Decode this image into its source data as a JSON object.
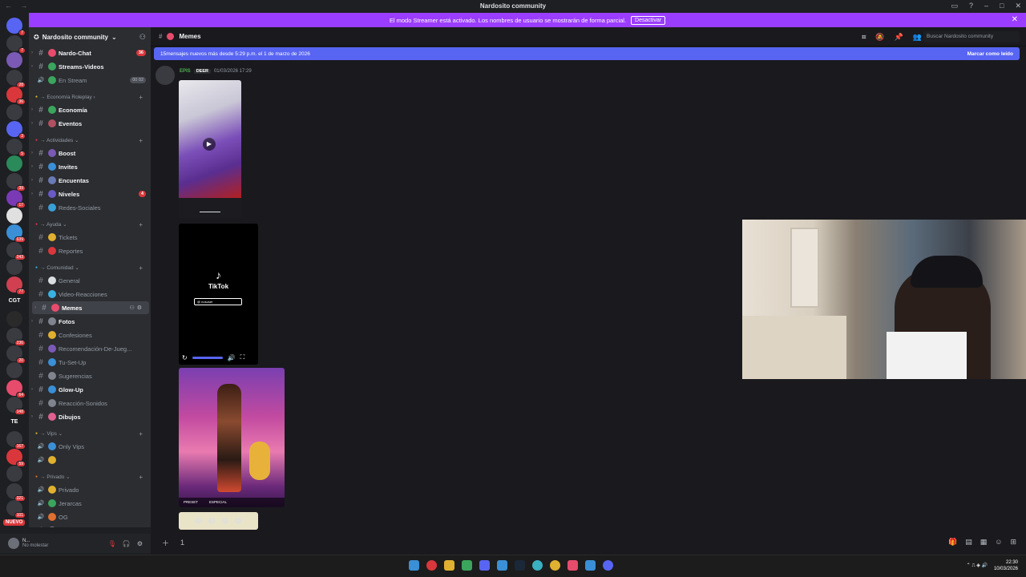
{
  "window": {
    "title": "Nardosito community",
    "nav": "← →"
  },
  "banner": {
    "text": "El modo Streamer está activado. Los nombres de usuario se mostrarán de forma parcial.",
    "button": "Desactivar"
  },
  "guild_badges": [
    "7",
    "7",
    "28",
    "36",
    "3",
    "5",
    "39",
    "17",
    "639",
    "243",
    "77",
    "12",
    "236",
    "20",
    "64",
    "148",
    "167",
    "59",
    "321",
    "101",
    "36",
    "77"
  ],
  "guild_text": [
    "CGT",
    "TE"
  ],
  "nuevo": "NUEVO",
  "server": {
    "name": "Nardosito community"
  },
  "channels": [
    {
      "type": "text",
      "name": "Nardo-Chat",
      "bright": true,
      "count": "36",
      "color": "#e74c6c"
    },
    {
      "type": "text",
      "name": "Streams-Videos",
      "bright": true,
      "color": "#3ba55d"
    },
    {
      "type": "voice",
      "name": "En Stream",
      "bright": false,
      "count": "00 02",
      "gray": true,
      "color": "#3ba55d"
    }
  ],
  "categories": [
    {
      "name": "→ Economía Roleplay ›",
      "channels": [
        {
          "name": "Economía",
          "bright": true,
          "color": "#3ba55d"
        },
        {
          "name": "Eventos",
          "bright": true,
          "color": "#b05060"
        }
      ]
    },
    {
      "name": "→ Actividades ⌄",
      "channels": [
        {
          "name": "Boost",
          "bright": true,
          "color": "#7a5ab5"
        },
        {
          "name": "Invites",
          "bright": true,
          "color": "#3a8fd6"
        },
        {
          "name": "Encuentas",
          "bright": true,
          "color": "#6a7ab5"
        },
        {
          "name": "Niveles",
          "bright": true,
          "count": "4",
          "color": "#6a5ac5"
        },
        {
          "name": "Redes-Sociales",
          "bright": false,
          "color": "#3a9fd6"
        }
      ]
    },
    {
      "name": "→ Ayuda ⌄",
      "channels": [
        {
          "name": "Tickets",
          "bright": false,
          "color": "#e0b030"
        },
        {
          "name": "Reportes",
          "bright": false,
          "color": "#da373c"
        }
      ]
    },
    {
      "name": "→ Comunidad ⌄",
      "channels": [
        {
          "name": "General",
          "bright": false,
          "color": "#dbdee1"
        },
        {
          "name": "Video-Reacciones",
          "bright": false,
          "color": "#3ab0e0"
        },
        {
          "name": "Memes",
          "bright": true,
          "selected": true,
          "color": "#e74c6c"
        },
        {
          "name": "Fotos",
          "bright": true,
          "color": "#80848e"
        },
        {
          "name": "Confesiones",
          "bright": false,
          "color": "#e0b030"
        },
        {
          "name": "Recomendación-De-Jueg...",
          "bright": false,
          "color": "#7a5ab5"
        },
        {
          "name": "Tu-Set-Up",
          "bright": false,
          "color": "#3a8fd6"
        },
        {
          "name": "Sugerencias",
          "bright": false,
          "color": "#80848e"
        },
        {
          "name": "Glow-Up",
          "bright": true,
          "color": "#3a8fd6"
        },
        {
          "name": "Reacción-Sonidos",
          "bright": false,
          "color": "#80848e"
        },
        {
          "name": "Dibujos",
          "bright": true,
          "color": "#e06090"
        }
      ]
    },
    {
      "name": "→ Vips ⌄",
      "channels": [
        {
          "name": "Only Vips",
          "bright": false,
          "color": "#3a8fd6"
        },
        {
          "name": "",
          "bright": false,
          "color": "#e0b030"
        }
      ]
    },
    {
      "name": "→ Privado ⌄",
      "channels": [
        {
          "name": "Privado",
          "bright": false,
          "color": "#e0b030"
        },
        {
          "name": "Jerarcas",
          "bright": false,
          "color": "#3ba55d"
        },
        {
          "name": "OG",
          "bright": false,
          "color": "#e07030"
        },
        {
          "name": "Musicas",
          "bright": false,
          "color": "#80848e"
        }
      ]
    }
  ],
  "user": {
    "name": "N...",
    "status": "No molestar"
  },
  "channel_header": {
    "name": "Memes",
    "search_placeholder": "Buscar Nardosito community"
  },
  "new_messages": {
    "text": "15mensajes nuevos más desde 5:29 p.m. el 1 de marzo de 2026",
    "mark": "Marcar como leído"
  },
  "message": {
    "author": "EPIS",
    "tag": "DEER",
    "timestamp": "01/03/2026 17:29"
  },
  "tiktok": {
    "label": "TikTok",
    "pill": "@ nosuser"
  },
  "image_footer": {
    "left": "PRESET",
    "right": "ESPECIAL"
  },
  "composer": {
    "text": "1"
  },
  "taskbar": {
    "time": "22:30",
    "date": "10/03/2026"
  }
}
